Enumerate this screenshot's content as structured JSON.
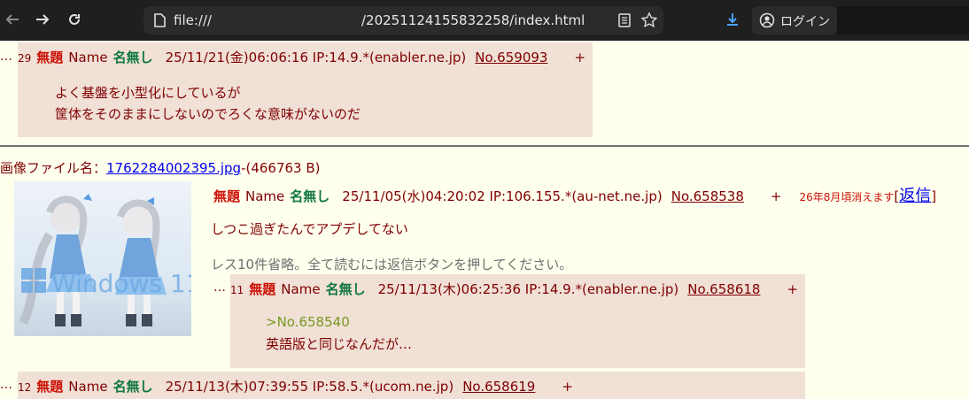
{
  "browser": {
    "url_scheme": "file:///",
    "url_path": "/20251124155832258/index.html",
    "login_label": "ログイン",
    "icons": [
      "back-icon",
      "forward-icon",
      "reload-icon",
      "page-icon",
      "reader-icon",
      "bookmark-star-icon",
      "download-icon",
      "account-icon"
    ]
  },
  "posts": {
    "p29": {
      "num": "29",
      "subject": "無題",
      "name_label": "Name",
      "name": "名無し",
      "date": "25/11/21(金)06:06:16 IP:14.9.*(enabler.ne.jp)",
      "no": "No.659093",
      "plus": "+",
      "lines": [
        "よく基盤を小型化にしているが",
        "筐体をそのままにしないのでろくな意味がないのだ"
      ]
    },
    "thread": {
      "file_label": "画像ファイル名：",
      "file_name": "1762284002395.jpg",
      "file_size": "-(466763 B)",
      "subject": "無題",
      "name_label": "Name",
      "name": "名無し",
      "date": "25/11/05(水)04:20:02 IP:106.155.*(au-net.ne.jp)",
      "no": "No.658538",
      "plus": "+",
      "expire": "26年8月頃消えます",
      "reply_open": "[",
      "reply_label": "返信",
      "reply_close": "]",
      "body": "しつこ過ぎたんでアプデしてない",
      "omitted": "レス10件省略。全て読むには返信ボタンを押してください。",
      "thumb_text": "Windows 11"
    },
    "p11": {
      "num": "11",
      "subject": "無題",
      "name_label": "Name",
      "name": "名無し",
      "date": "25/11/13(木)06:25:36 IP:14.9.*(enabler.ne.jp)",
      "no": "No.658618",
      "plus": "+",
      "quote": ">No.658540",
      "line": "英語版と同じなんだが…"
    },
    "p12": {
      "num": "12",
      "subject": "無題",
      "name_label": "Name",
      "name": "名無し",
      "date": "25/11/13(木)07:39:55 IP:58.5.*(ucom.ne.jp)",
      "no": "No.658619",
      "plus": "+"
    }
  },
  "dots": "…",
  "colors": {
    "reply_bg": "#f0e0d6",
    "page_bg": "#ffffee",
    "subject": "#cc1105",
    "name": "#117743",
    "text": "#800000",
    "quote": "#789922",
    "link": "#0000ee"
  }
}
